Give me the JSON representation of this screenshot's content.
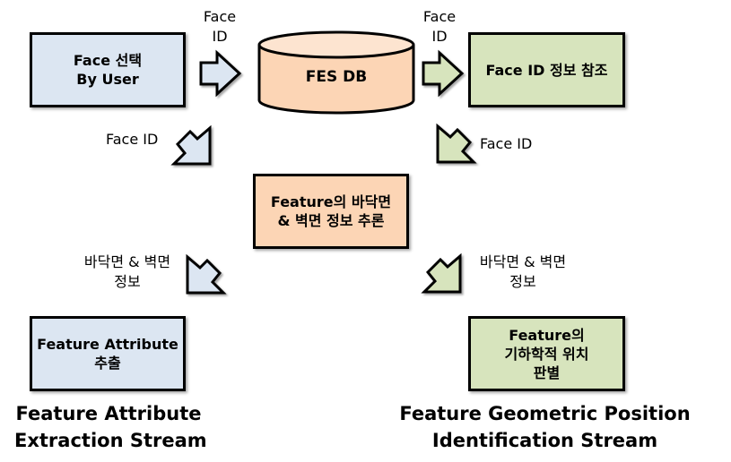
{
  "colors": {
    "blue_fill": "#dce6f2",
    "green_fill": "#d7e4bd",
    "peach_fill": "#fcd5b5",
    "border": "#000000"
  },
  "nodes": {
    "face_select": {
      "lines": [
        "Face 선택",
        "By User"
      ]
    },
    "fes_db": {
      "label": "FES DB"
    },
    "face_id_ref": {
      "lines": [
        "Face ID 정보 참조"
      ]
    },
    "infer": {
      "lines": [
        "Feature의 바닥면",
        "& 벽면 정보 추론"
      ]
    },
    "attr_extract": {
      "lines": [
        "Feature Attribute",
        "추출"
      ]
    },
    "geo_position": {
      "lines": [
        "Feature의",
        "기하학적 위치",
        "판별"
      ]
    }
  },
  "arrow_labels": {
    "top_left": [
      "Face",
      "ID"
    ],
    "top_right": [
      "Face",
      "ID"
    ],
    "mid_left": [
      "Face ID"
    ],
    "mid_right": [
      "Face ID"
    ],
    "low_left": [
      "바닥면 & 벽면",
      "정보"
    ],
    "low_right": [
      "바닥면 & 벽면",
      "정보"
    ]
  },
  "streams": {
    "left": [
      "Feature Attribute",
      "Extraction Stream"
    ],
    "right": [
      "Feature Geometric Position",
      "Identification Stream"
    ]
  }
}
